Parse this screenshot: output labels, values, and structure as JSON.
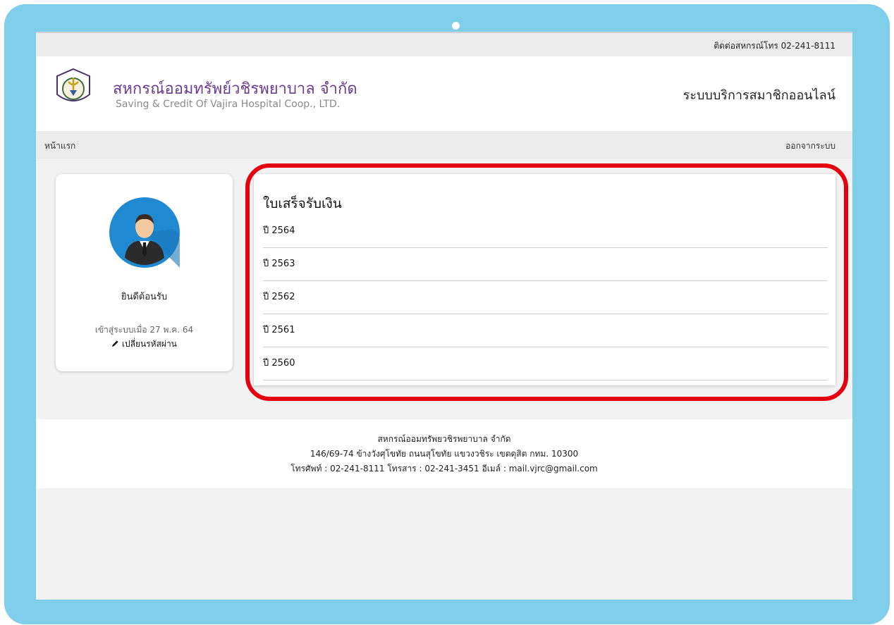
{
  "header": {
    "contact": "ติดต่อสหกรณ์โทร 02-241-8111",
    "brand_th": "สหกรณ์ออมทรัพย์วชิรพยาบาล จำกัด",
    "brand_en": "Saving & Credit Of Vajira Hospital Coop., LTD.",
    "system_title": "ระบบบริการสมาชิกออนไลน์"
  },
  "nav": {
    "home": "หน้าแรก",
    "logout": "ออกจากระบบ"
  },
  "profile": {
    "welcome": "ยินดีต้อนรับ",
    "last_login": "เข้าสู่ระบบเมื่อ 27 พ.ค. 64",
    "change_password": "เปลี่ยนรหัสผ่าน",
    "icons": {
      "avatar": "user-avatar-icon",
      "pencil": "pencil-icon"
    }
  },
  "receipts": {
    "title": "ใบเสร็จรับเงิน",
    "years": [
      "ปี 2564",
      "ปี 2563",
      "ปี 2562",
      "ปี 2561",
      "ปี 2560"
    ]
  },
  "footer": {
    "line1": "สหกรณ์ออมทรัพยวชิรพยาบาล จำกัด",
    "line2": "146/69-74 ข้างวังศุโขทัย ถนนสุโขทัย แขวงวชิระ เขตดุสิต กทม. 10300",
    "line3": "โทรศัพท์ : 02-241-8111 โทรสาร : 02-241-3451 อีเมล์ : mail.vjrc@gmail.com"
  },
  "colors": {
    "device_frame": "#7fcfea",
    "brand_purple": "#6a3d8f",
    "highlight_red": "#e5000f"
  }
}
